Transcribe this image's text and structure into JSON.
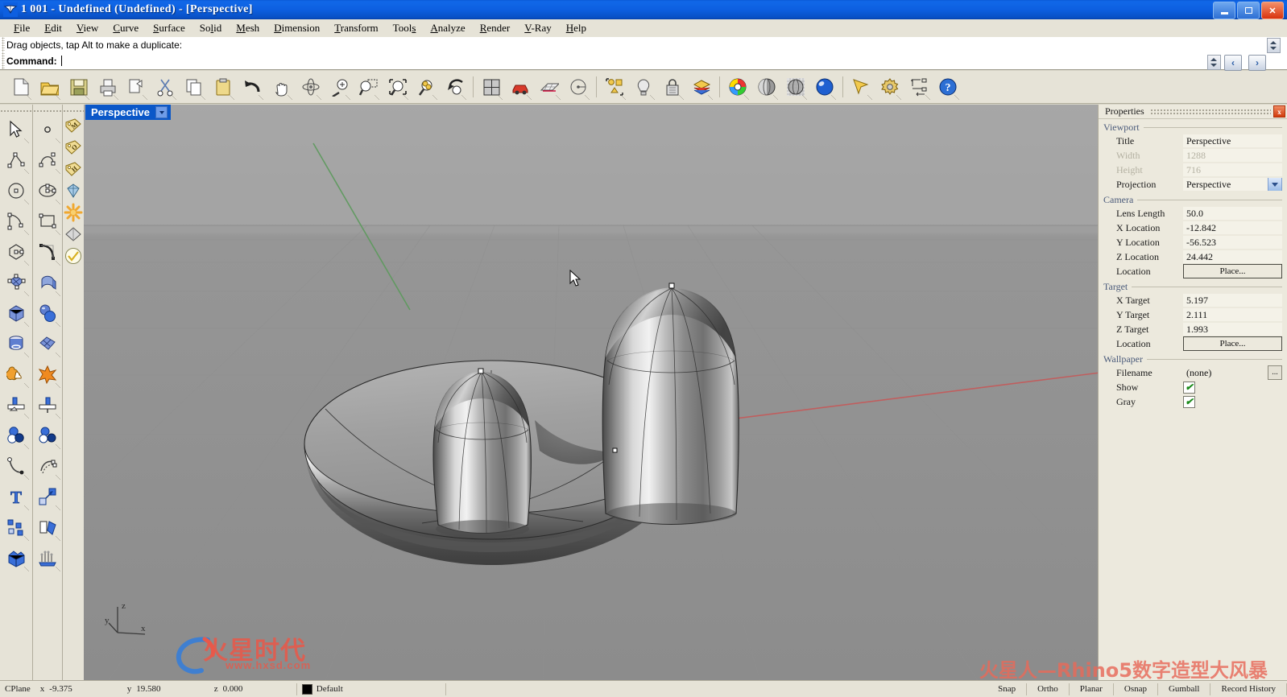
{
  "window": {
    "title": "1 001 - Undefined (Undefined) - [Perspective]",
    "app_icon": "rhino-icon",
    "minimize_label": "Minimize",
    "maximize_label": "Restore",
    "close_label": "Close"
  },
  "menubar": {
    "items": [
      {
        "label": "File",
        "mnemonic": "F"
      },
      {
        "label": "Edit",
        "mnemonic": "E"
      },
      {
        "label": "View",
        "mnemonic": "V"
      },
      {
        "label": "Curve",
        "mnemonic": "C"
      },
      {
        "label": "Surface",
        "mnemonic": "S"
      },
      {
        "label": "Solid",
        "mnemonic": "l"
      },
      {
        "label": "Mesh",
        "mnemonic": "M"
      },
      {
        "label": "Dimension",
        "mnemonic": "D"
      },
      {
        "label": "Transform",
        "mnemonic": "T"
      },
      {
        "label": "Tools",
        "mnemonic": "s"
      },
      {
        "label": "Analyze",
        "mnemonic": "A"
      },
      {
        "label": "Render",
        "mnemonic": "R"
      },
      {
        "label": "V-Ray",
        "mnemonic": "V"
      },
      {
        "label": "Help",
        "mnemonic": "H"
      }
    ]
  },
  "prompt": {
    "history_text": "Drag objects, tap Alt to make a duplicate:",
    "command_label": "Command:",
    "command_value": "",
    "command_placeholder": ""
  },
  "main_toolbar": {
    "buttons": [
      {
        "name": "new-file-icon",
        "tip": "New"
      },
      {
        "name": "open-file-icon",
        "tip": "Open"
      },
      {
        "name": "save-file-icon",
        "tip": "Save"
      },
      {
        "name": "print-icon",
        "tip": "Print"
      },
      {
        "name": "copy-to-clipboard-icon",
        "tip": "Copy to clipboard"
      },
      {
        "name": "cut-icon",
        "tip": "Cut"
      },
      {
        "name": "copy-icon",
        "tip": "Copy"
      },
      {
        "name": "paste-icon",
        "tip": "Paste"
      },
      {
        "name": "undo-icon",
        "tip": "Undo"
      },
      {
        "name": "pan-hand-icon",
        "tip": "Pan"
      },
      {
        "name": "rotate-view-icon",
        "tip": "Rotate view"
      },
      {
        "name": "zoom-in-out-icon",
        "tip": "Zoom in/out"
      },
      {
        "name": "zoom-window-icon",
        "tip": "Zoom window"
      },
      {
        "name": "zoom-extents-icon",
        "tip": "Zoom extents"
      },
      {
        "name": "zoom-selected-icon",
        "tip": "Zoom selected"
      },
      {
        "name": "undo-view-icon",
        "tip": "Undo view change"
      },
      {
        "name": "viewport-layout-icon",
        "tip": "Viewport layout"
      },
      {
        "name": "render-car-icon",
        "tip": "Render"
      },
      {
        "name": "grid-settings-icon",
        "tip": "Grid settings"
      },
      {
        "name": "named-cplane-icon",
        "tip": "Set CPlane"
      },
      {
        "name": "group-objects-icon",
        "tip": "Group"
      },
      {
        "name": "light-bulb-icon",
        "tip": "Create light"
      },
      {
        "name": "lock-object-icon",
        "tip": "Lock object"
      },
      {
        "name": "layers-icon",
        "tip": "Layers"
      },
      {
        "name": "color-wheel-icon",
        "tip": "Object color"
      },
      {
        "name": "shaded-view-icon",
        "tip": "Shaded viewport"
      },
      {
        "name": "ghosted-view-icon",
        "tip": "Ghosted viewport"
      },
      {
        "name": "rendered-view-icon",
        "tip": "Rendered viewport"
      },
      {
        "name": "select-arrow-icon",
        "tip": "Select"
      },
      {
        "name": "options-gear-icon",
        "tip": "Options"
      },
      {
        "name": "dimension-icon",
        "tip": "Dimension"
      },
      {
        "name": "help-icon",
        "tip": "Help"
      }
    ]
  },
  "left_toolbar": {
    "column1": [
      {
        "name": "select-pointer-icon",
        "tip": "Select objects"
      },
      {
        "name": "polyline-icon",
        "tip": "Polyline"
      },
      {
        "name": "circle-icon",
        "tip": "Circle"
      },
      {
        "name": "arc-icon",
        "tip": "Arc"
      },
      {
        "name": "polygon-icon",
        "tip": "Polygon"
      },
      {
        "name": "surface-from-points-icon",
        "tip": "Surface from points"
      },
      {
        "name": "box-solid-icon",
        "tip": "Box"
      },
      {
        "name": "cylinder-solid-icon",
        "tip": "Cylinder"
      },
      {
        "name": "boolean-union-icon",
        "tip": "Boolean union"
      },
      {
        "name": "trim-icon",
        "tip": "Trim"
      },
      {
        "name": "boolean-spheres-icon",
        "tip": "Boolean operations"
      },
      {
        "name": "curve-fillet-icon",
        "tip": "Fillet curves"
      },
      {
        "name": "text-object-icon",
        "tip": "Text object"
      },
      {
        "name": "scatter-objects-icon",
        "tip": "Array"
      },
      {
        "name": "cube-extrude-icon",
        "tip": "Extrude solid"
      }
    ],
    "column2": [
      {
        "name": "point-object-icon",
        "tip": "Point"
      },
      {
        "name": "curve-interp-icon",
        "tip": "Interpolate curve"
      },
      {
        "name": "ellipse-icon",
        "tip": "Ellipse"
      },
      {
        "name": "rectangle-icon",
        "tip": "Rectangle"
      },
      {
        "name": "curve-blend-icon",
        "tip": "Blend curve"
      },
      {
        "name": "extrude-surface-icon",
        "tip": "Extrude surface"
      },
      {
        "name": "sphere-solid-icon",
        "tip": "Sphere"
      },
      {
        "name": "surface-patch-icon",
        "tip": "Patch surface"
      },
      {
        "name": "explode-icon",
        "tip": "Explode"
      },
      {
        "name": "split-icon",
        "tip": "Split"
      },
      {
        "name": "boolean-diff-icon",
        "tip": "Boolean difference"
      },
      {
        "name": "offset-curve-icon",
        "tip": "Offset curve"
      },
      {
        "name": "move-object-icon",
        "tip": "Move"
      },
      {
        "name": "mirror-object-icon",
        "tip": "Mirror"
      },
      {
        "name": "loft-surface-icon",
        "tip": "Loft"
      }
    ],
    "osnap_column": [
      {
        "name": "osnap-mid-tag-icon",
        "tip": "Mid osnap",
        "label": "M"
      },
      {
        "name": "osnap-cen-tag-icon",
        "tip": "Center osnap",
        "label": "O"
      },
      {
        "name": "osnap-end-tag-icon",
        "tip": "End osnap",
        "label": "H"
      },
      {
        "name": "gem-render-icon",
        "tip": "Render material"
      },
      {
        "name": "sun-light-icon",
        "tip": "Sun light"
      },
      {
        "name": "diamond-plane-icon",
        "tip": "Plane"
      },
      {
        "name": "check-circle-icon",
        "tip": "Accept"
      }
    ]
  },
  "viewport": {
    "tab_label": "Perspective",
    "tab_dropdown_icon": "chevron-down-icon",
    "axis_labels": {
      "x": "x",
      "y": "y",
      "z": "z"
    },
    "cursor_icon": "arrow-cursor",
    "model_description": "Two shaded dome-capped solids on a rounded oval base"
  },
  "properties": {
    "panel_title": "Properties",
    "close_label": "x",
    "groups": [
      {
        "title": "Viewport",
        "rows": [
          {
            "label": "Title",
            "value": "Perspective",
            "kind": "text",
            "disabled": false
          },
          {
            "label": "Width",
            "value": "1288",
            "kind": "text",
            "disabled": true
          },
          {
            "label": "Height",
            "value": "716",
            "kind": "text",
            "disabled": true
          },
          {
            "label": "Projection",
            "value": "Perspective",
            "kind": "combo",
            "disabled": false
          }
        ]
      },
      {
        "title": "Camera",
        "rows": [
          {
            "label": "Lens Length",
            "value": "50.0",
            "kind": "text",
            "disabled": false
          },
          {
            "label": "X Location",
            "value": "-12.842",
            "kind": "text",
            "disabled": false
          },
          {
            "label": "Y Location",
            "value": "-56.523",
            "kind": "text",
            "disabled": false
          },
          {
            "label": "Z Location",
            "value": "24.442",
            "kind": "text",
            "disabled": false
          },
          {
            "label": "Location",
            "value": "Place...",
            "kind": "button",
            "disabled": false
          }
        ]
      },
      {
        "title": "Target",
        "rows": [
          {
            "label": "X Target",
            "value": "5.197",
            "kind": "text",
            "disabled": false
          },
          {
            "label": "Y Target",
            "value": "2.111",
            "kind": "text",
            "disabled": false
          },
          {
            "label": "Z Target",
            "value": "1.993",
            "kind": "text",
            "disabled": false
          },
          {
            "label": "Location",
            "value": "Place...",
            "kind": "button",
            "disabled": false
          }
        ]
      },
      {
        "title": "Wallpaper",
        "rows": [
          {
            "label": "Filename",
            "value": "(none)",
            "kind": "browse",
            "disabled": false
          },
          {
            "label": "Show",
            "value": "",
            "kind": "checkbox",
            "checked": true,
            "disabled": false
          },
          {
            "label": "Gray",
            "value": "",
            "kind": "checkbox",
            "checked": true,
            "disabled": false
          }
        ]
      }
    ]
  },
  "statusbar": {
    "cplane_label": "CPlane",
    "x_label": "x",
    "x_value": "-9.375",
    "y_label": "y",
    "y_value": "19.580",
    "z_label": "z",
    "z_value": "0.000",
    "layer_name": "Default",
    "layer_color": "#000000",
    "toggles": [
      "Snap",
      "Ortho",
      "Planar",
      "Osnap",
      "Gumball",
      "Record History"
    ]
  },
  "watermarks": {
    "left_brand": "火星时代",
    "left_url": "www.hxsd.com",
    "right_text": "火星人—Rhino5数字造型大风暴",
    "color": "#e8594a"
  },
  "colors": {
    "titlebar_blue": "#0d5fe0",
    "panel_bg": "#ece9dd",
    "toolbar_bg": "#e6e3d7",
    "viewport_gray": "#9a9a9a",
    "accent_tab": "#0a57c8",
    "x_axis_red": "#c05050",
    "y_axis_green": "#5a9a5a"
  }
}
